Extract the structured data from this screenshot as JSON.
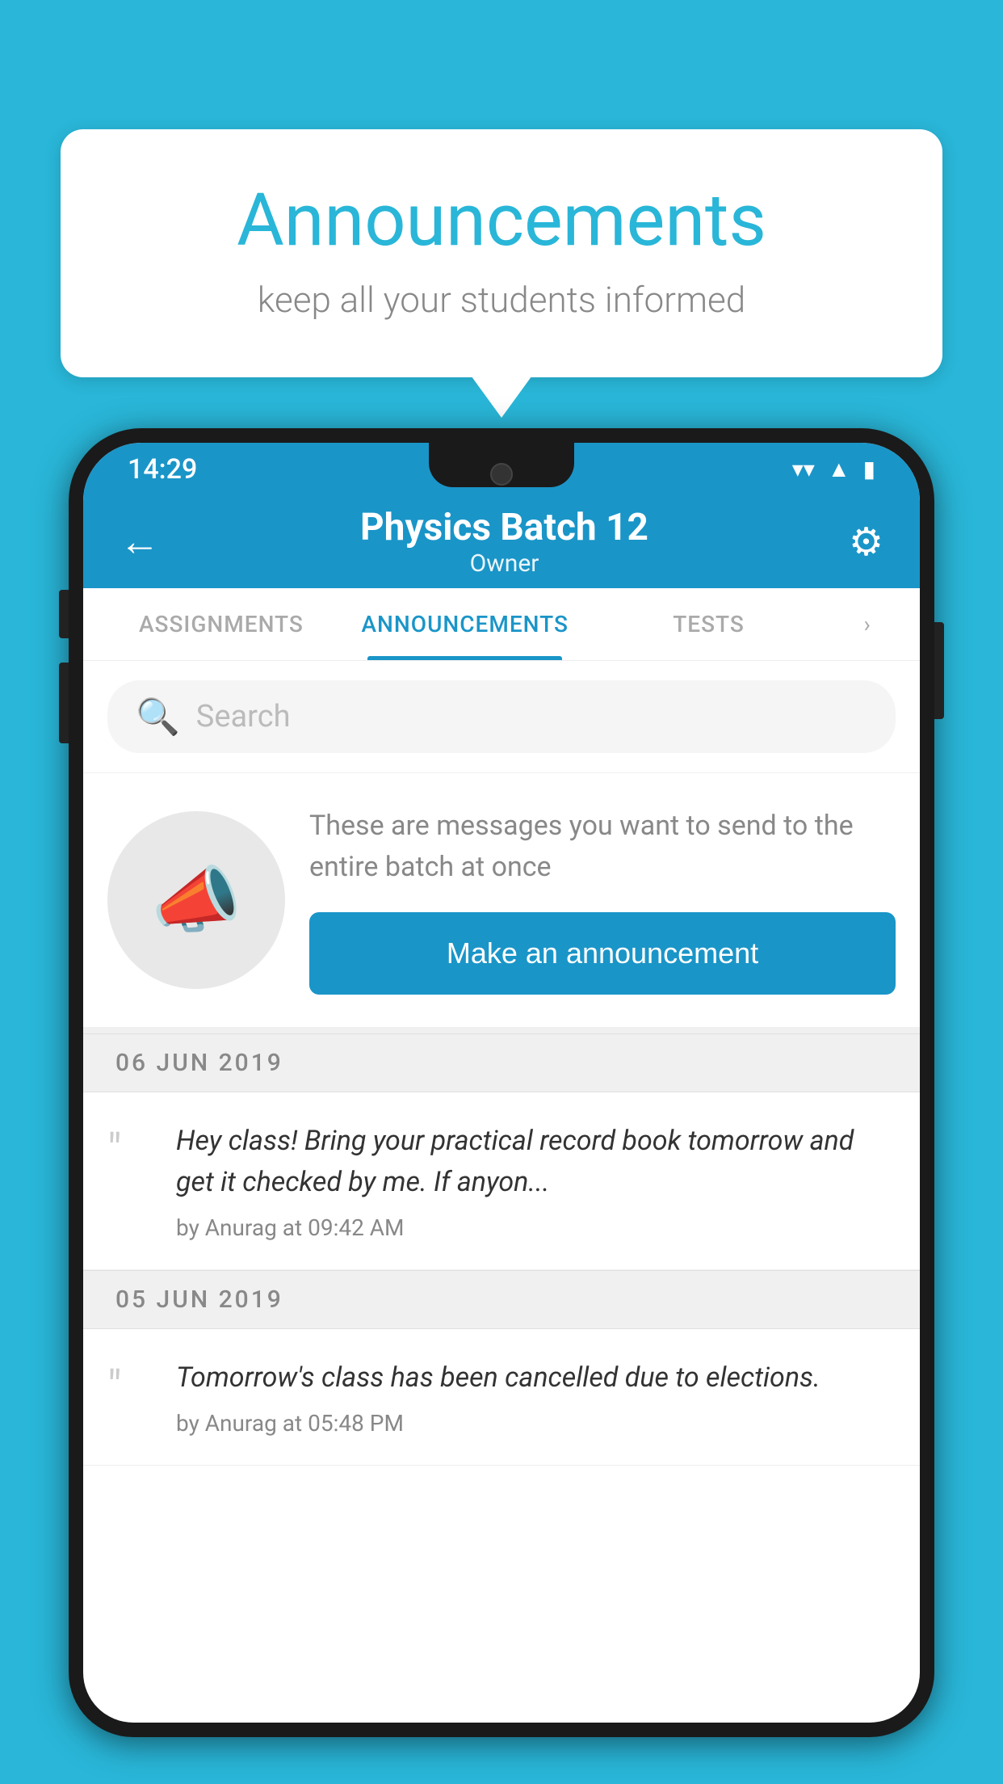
{
  "background_color": "#29b6d8",
  "speech_bubble": {
    "title": "Announcements",
    "subtitle": "keep all your students informed"
  },
  "phone": {
    "status_bar": {
      "time": "14:29",
      "icons": [
        "wifi",
        "signal",
        "battery"
      ]
    },
    "header": {
      "title": "Physics Batch 12",
      "subtitle": "Owner",
      "back_label": "←",
      "gear_label": "⚙"
    },
    "tabs": [
      {
        "label": "ASSIGNMENTS",
        "active": false
      },
      {
        "label": "ANNOUNCEMENTS",
        "active": true
      },
      {
        "label": "TESTS",
        "active": false
      }
    ],
    "search": {
      "placeholder": "Search"
    },
    "promo": {
      "description": "These are messages you want to send to the entire batch at once",
      "button_label": "Make an announcement"
    },
    "announcements": [
      {
        "date": "06  JUN  2019",
        "text": "Hey class! Bring your practical record book tomorrow and get it checked by me. If anyon...",
        "author": "by Anurag at 09:42 AM"
      },
      {
        "date": "05  JUN  2019",
        "text": "Tomorrow's class has been cancelled due to elections.",
        "author": "by Anurag at 05:48 PM"
      }
    ]
  }
}
